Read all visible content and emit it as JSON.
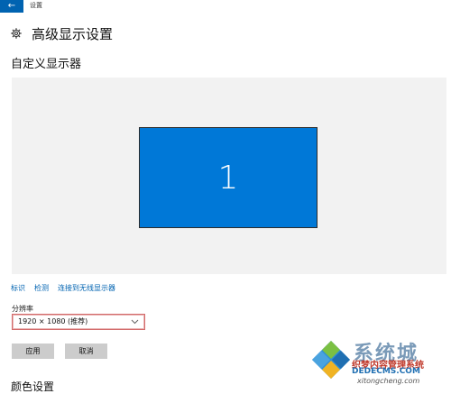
{
  "window": {
    "back_glyph": "←",
    "app_title": "设置"
  },
  "header": {
    "icon": "gear-icon",
    "title": "高级显示设置"
  },
  "customize": {
    "title": "自定义显示器"
  },
  "display": {
    "monitor_number": "1",
    "monitor_color": "#0078d7"
  },
  "links": {
    "identify": "标识",
    "detect": "检测",
    "connect_wireless": "连接到无线显示器"
  },
  "resolution": {
    "label": "分辨率",
    "value": "1920 × 1080 (推荐)"
  },
  "buttons": {
    "apply": "应用",
    "cancel": "取消"
  },
  "color_settings": {
    "title": "颜色设置"
  },
  "watermark": {
    "brand": "系统城",
    "line1": "织梦内容管理系统",
    "line2": "DEDECMS.COM",
    "line3": "xitongcheng.com"
  },
  "colors": {
    "accent": "#0063b1",
    "select_border": "#d36b6b",
    "button_bg": "#cccccc"
  }
}
